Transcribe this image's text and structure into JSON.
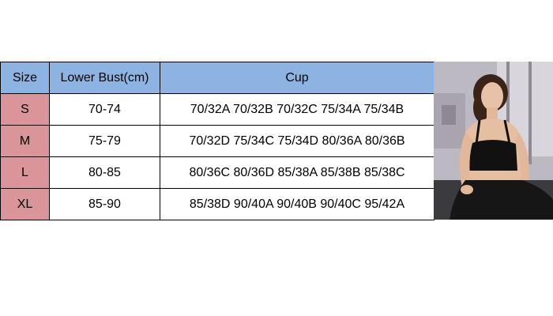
{
  "table": {
    "headers": [
      "Size",
      "Lower Bust(cm)",
      "Cup"
    ],
    "rows": [
      {
        "size": "S",
        "lower_bust": "70-74",
        "cup": "70/32A 70/32B 70/32C 75/34A 75/34B"
      },
      {
        "size": "M",
        "lower_bust": "75-79",
        "cup": "70/32D 75/34C 75/34D 80/36A 80/36B"
      },
      {
        "size": "L",
        "lower_bust": "80-85",
        "cup": "80/36C 80/36D 85/38A 85/38B 85/38C"
      },
      {
        "size": "XL",
        "lower_bust": "85-90",
        "cup": "85/38D 90/40A 90/40B 90/40C 95/42A"
      }
    ]
  },
  "colors": {
    "header_bg": "#8db3e2",
    "size_cell_bg": "#d9959a"
  }
}
